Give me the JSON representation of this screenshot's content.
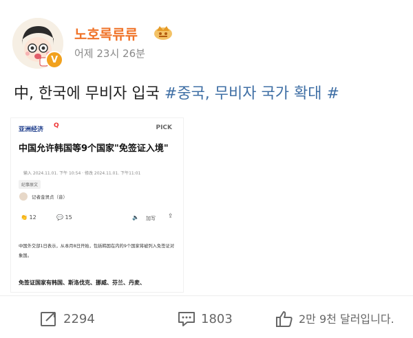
{
  "post": {
    "username": "노호록류류",
    "timestamp": "어제 23시 26분",
    "text_prefix": "中, 한국에 무비자 입국 ",
    "hashtag": "#중국, 무비자 국가 확대 #"
  },
  "article": {
    "source": "亚洲经济",
    "pick": "PICK",
    "title": "中国允许韩国等9个国家\"免签证入境\"",
    "meta": "输入 2024.11.01. 下午 10:54 · 修改 2024.11.01. 下午11:01",
    "chip": "纪事原文",
    "reporter": "记者金贤贞（音）",
    "like_count": "12",
    "comment_count": "15",
    "size_label": "加写",
    "body1": "中国外交部1日表示，从本月8日开始，包括韩国在内的9个国家将被列入免签证对象国。",
    "body2": "免签证国家有韩国、斯洛伐克、挪威、芬兰、丹麦、"
  },
  "actions": {
    "share_count": "2294",
    "comment_count": "1803",
    "like_label": "2만 9천 달러입니다."
  },
  "colors": {
    "username": "#f0742a",
    "hashtag": "#3f6fa5",
    "badge": "#f1a11e"
  },
  "icons": [
    "crown-icon",
    "verified-v-badge",
    "share-icon",
    "comment-icon",
    "like-icon",
    "speaker-icon",
    "external-share-icon"
  ]
}
